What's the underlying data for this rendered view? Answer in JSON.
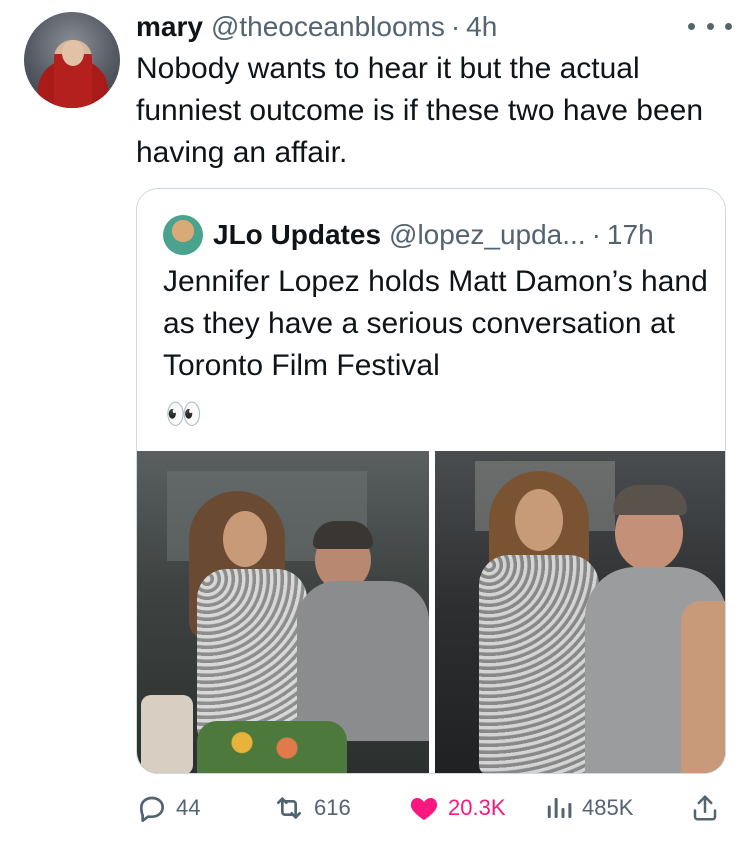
{
  "tweet": {
    "author_name": "mary",
    "author_handle": "@theoceanblooms",
    "dot": "·",
    "time": "4h",
    "text": "Nobody wants to hear it but the actual funniest outcome is if these two have been having an affair."
  },
  "quote": {
    "author_name": "JLo Updates",
    "author_handle": "@lopez_upda...",
    "dot": "·",
    "time": "17h",
    "text": "Jennifer Lopez holds Matt Damon’s hand as they have a serious conversation at Toronto Film Festival",
    "emoji": "👀",
    "media": [
      "photo-1",
      "photo-2"
    ]
  },
  "actions": {
    "replies": "44",
    "retweets": "616",
    "likes": "20.3K",
    "views": "485K"
  },
  "icons": {
    "reply": "reply-icon",
    "retweet": "retweet-icon",
    "like": "heart-icon",
    "views": "views-icon",
    "share": "share-icon",
    "more": "more-icon"
  },
  "colors": {
    "like_active": "#f91880",
    "secondary_text": "#536471",
    "border": "#cfd9de"
  }
}
